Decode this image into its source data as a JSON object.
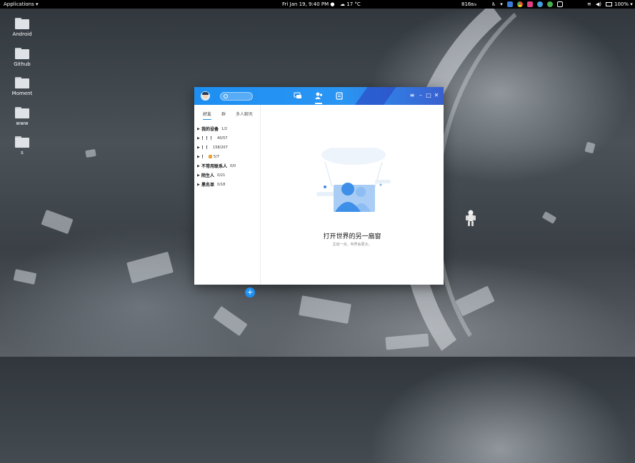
{
  "topbar": {
    "applications": "Applications",
    "clock": "Fri Jan 19,  9:40 PM",
    "weather": "17 °C",
    "net_speed": "816",
    "net_unit": "B/s",
    "battery": "100%"
  },
  "desktop": {
    "icons": [
      {
        "label": "Android"
      },
      {
        "label": "Github"
      },
      {
        "label": "Moment"
      },
      {
        "label": "www"
      },
      {
        "label": "s"
      }
    ]
  },
  "qq": {
    "tabs": [
      "好友",
      "群",
      "多人聊天"
    ],
    "groups": [
      {
        "name": "我的设备",
        "count": "1/2"
      },
      {
        "name": "！！！",
        "count": "40/57"
      },
      {
        "name": "！！",
        "count": "158/207"
      },
      {
        "name": "！",
        "count": "5/7"
      },
      {
        "name": "不常用联系人",
        "count": "0/0"
      },
      {
        "name": "陌生人",
        "count": "0/21"
      },
      {
        "name": "黑名单",
        "count": "0/18"
      }
    ],
    "empty_title": "打开世界的另一扇窗",
    "empty_subtitle": "主动一点，世界会更大。",
    "fab_label": "+"
  },
  "colors": {
    "accent": "#1d8ff2",
    "titlebar_end": "#3a5fcf"
  }
}
